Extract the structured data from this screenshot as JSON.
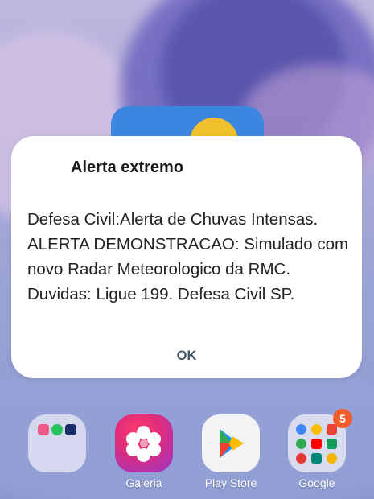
{
  "alert": {
    "title": "Alerta extremo",
    "body": "Defesa Civil:Alerta de Chuvas Intensas. ALERTA DEMONSTRACAO: Simulado com novo Radar Meteorologico da RMC. Duvidas: Ligue 199. Defesa Civil SP.",
    "ok_label": "OK"
  },
  "dock": {
    "folder_left": {
      "label": "",
      "icons": [
        "messages-icon",
        "whatsapp-icon",
        "itau-icon"
      ]
    },
    "galeria": {
      "label": "Galeria",
      "icon": "flower-icon"
    },
    "play_store": {
      "label": "Play Store",
      "icon": "play-store-icon"
    },
    "google": {
      "label": "Google",
      "badge": "5",
      "icons": [
        "google-icon",
        "chrome-icon",
        "gmail-icon",
        "maps-icon",
        "youtube-icon",
        "drive-icon",
        "youtube-music-icon",
        "meet-icon",
        "photos-icon"
      ]
    }
  },
  "colors": {
    "dialog_bg": "#ffffff",
    "ok_text": "#465568",
    "badge": "#f25c2b"
  }
}
